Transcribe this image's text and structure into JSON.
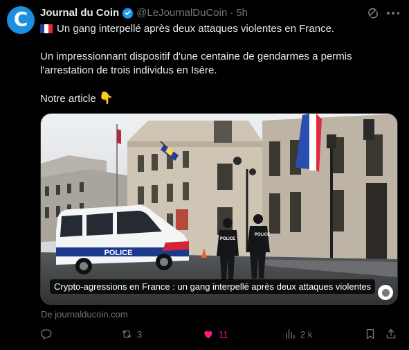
{
  "author": {
    "avatar_letter": "C",
    "display_name": "Journal du Coin",
    "handle": "@LeJournalDuCoin",
    "separator": "·",
    "time": "5h"
  },
  "tweet": {
    "line1": "Un gang interpellé après deux attaques violentes en France.",
    "line2": "Un impressionnant dispositif d'une centaine de gendarmes a permis",
    "line3": "l'arrestation de trois individus en Isère.",
    "line4": "Notre article",
    "emoji": "👇"
  },
  "card": {
    "caption": "Crypto-agressions en France : un gang interpellé après deux attaques violentes",
    "van_text": "POLICE",
    "officer_label": "POLICE",
    "source": "De journalducoin.com"
  },
  "actions": {
    "replies": "",
    "retweets": "3",
    "likes": "11",
    "views": "2 k"
  },
  "colors": {
    "accent": "#1d9bf0",
    "like": "#f91880",
    "muted": "#71767b",
    "brand": "#1d8fe0"
  },
  "icons": [
    "verified-badge-icon",
    "grok-icon",
    "more-icon",
    "france-flag-icon",
    "pointing-down-emoji",
    "reply-icon",
    "retweet-icon",
    "heart-icon",
    "views-icon",
    "bookmark-icon",
    "share-icon"
  ]
}
